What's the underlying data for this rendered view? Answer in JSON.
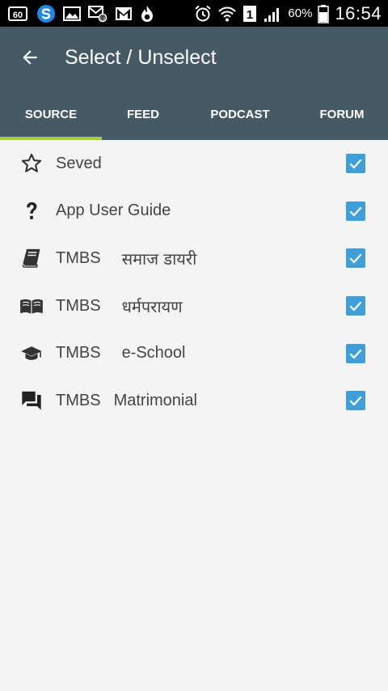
{
  "status_bar": {
    "battery_percent": "60%",
    "time": "16:54",
    "icons_left": [
      "sixty-badge-icon",
      "s-app-icon",
      "image-icon",
      "mail-attachment-icon",
      "gmail-icon",
      "flame-icon"
    ],
    "icons_right": [
      "alarm-icon",
      "wifi-icon",
      "sim-1-icon",
      "signal-icon",
      "battery-icon"
    ]
  },
  "header": {
    "title": "Select / Unselect"
  },
  "tabs": [
    {
      "label": "SOURCE",
      "active": true
    },
    {
      "label": "FEED",
      "active": false
    },
    {
      "label": "PODCAST",
      "active": false
    },
    {
      "label": "FORUM",
      "active": false
    }
  ],
  "items": [
    {
      "label": "Seved",
      "sub": "",
      "icon": "star-outline-icon",
      "checked": true
    },
    {
      "label": "App User Guide",
      "sub": "",
      "icon": "question-icon",
      "checked": true
    },
    {
      "label": "TMBS",
      "sub": "समाज डायरी",
      "icon": "book-icon",
      "checked": true
    },
    {
      "label": "TMBS",
      "sub": "धर्मपरायण",
      "icon": "open-book-icon",
      "checked": true
    },
    {
      "label": "TMBS",
      "sub": "e-School",
      "icon": "graduation-cap-icon",
      "checked": true
    },
    {
      "label": "TMBS",
      "sub": "Matrimonial",
      "icon": "forum-icon",
      "checked": true
    }
  ],
  "colors": {
    "app_bar": "#455a64",
    "tab_indicator": "#a8cd3b",
    "checkbox": "#3f9fd6",
    "background": "#f4f4f4"
  }
}
